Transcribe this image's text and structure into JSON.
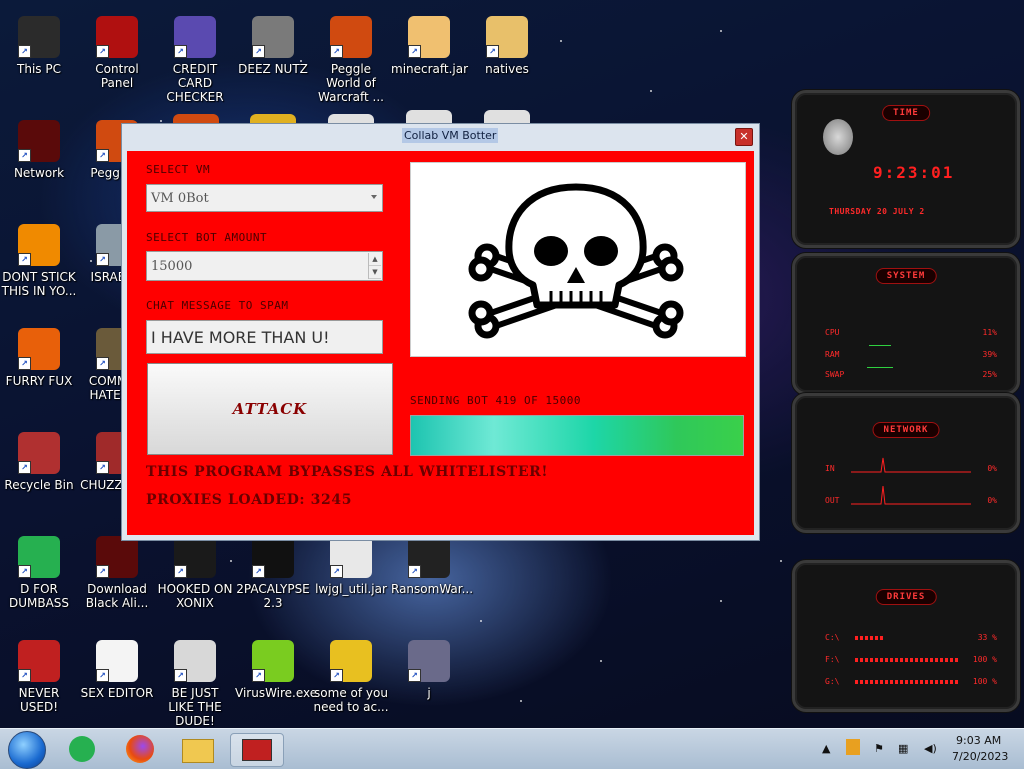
{
  "desktop": {
    "icons": [
      {
        "label": "This PC",
        "icon": "computer-icon",
        "color": "#2b2b2b"
      },
      {
        "label": "Control Panel",
        "icon": "control-panel-icon",
        "color": "#b01010"
      },
      {
        "label": "CREDIT CARD CHECKER",
        "icon": "credit-card-icon",
        "color": "#5a4ab0"
      },
      {
        "label": "DEEZ NUTZ",
        "icon": "windows-stack-icon",
        "color": "#7a7a7a"
      },
      {
        "label": "Peggle World of Warcraft ...",
        "icon": "peggle-icon",
        "color": "#d04a10"
      },
      {
        "label": "minecraft.jar",
        "icon": "cartoon-jar-icon",
        "color": "#f0c070"
      },
      {
        "label": "natives",
        "icon": "folder-icon",
        "color": "#e8c06a"
      },
      {
        "label": "Network",
        "icon": "alien-network-icon",
        "color": "#5a0a0a"
      },
      {
        "label": "Peggle D",
        "icon": "peggle-icon",
        "color": "#d04a10"
      },
      {
        "label": "DONT STICK THIS IN YO...",
        "icon": "vlc-cone-icon",
        "color": "#f08a00"
      },
      {
        "label": "ISRAEL S",
        "icon": "water-faucet-icon",
        "color": "#8a9aa6"
      },
      {
        "label": "FURRY FUX",
        "icon": "firefox-icon",
        "color": "#e8600a"
      },
      {
        "label": "COMMUN HATE THI",
        "icon": "money-bag-icon",
        "color": "#6a5a3a"
      },
      {
        "label": "Recycle Bin",
        "icon": "recycle-bin-icon",
        "color": "#b03030"
      },
      {
        "label": "CHUZZ CUM",
        "icon": "chuzzle-icon",
        "color": "#a02a2a"
      },
      {
        "label": "D FOR DUMBASS",
        "icon": "feedly-icon",
        "color": "#26b050"
      },
      {
        "label": "Download Black Ali...",
        "icon": "alien-download-icon",
        "color": "#5a0a0a"
      },
      {
        "label": "HOOKED ON XONIX",
        "icon": "xonix-icon",
        "color": "#1a1a1a"
      },
      {
        "label": "2PACALYPSE 2.3",
        "icon": "terminal-icon",
        "color": "#111111"
      },
      {
        "label": "lwjgl_util.jar",
        "icon": "java-icon",
        "color": "#e8e8e8"
      },
      {
        "label": "RansomWar...",
        "icon": "skull-icon",
        "color": "#222222"
      },
      {
        "label": "NEVER USED!",
        "icon": "dev-cpp-icon",
        "color": "#c02020"
      },
      {
        "label": "SEX EDITOR",
        "icon": "hxd-icon",
        "color": "#f4f4f4"
      },
      {
        "label": "BE JUST LIKE THE DUDE!",
        "icon": "santa-icon",
        "color": "#d8d8d8"
      },
      {
        "label": "VirusWire.exe",
        "icon": "limewire-icon",
        "color": "#7acc20"
      },
      {
        "label": "some of you need to ac...",
        "icon": "beaver-icon",
        "color": "#e8c020"
      },
      {
        "label": "j",
        "icon": "shortcut-file-icon",
        "color": "#6a6a8a"
      }
    ],
    "partial_icons": [
      {
        "icon": "peggle-icon",
        "color": "#d04a10"
      },
      {
        "icon": "deluge-icon",
        "color": "#e0b020"
      },
      {
        "icon": "app-icon",
        "color": "#e0e0e0"
      },
      {
        "icon": "shortcut-file-icon",
        "color": "#e0e0e0"
      },
      {
        "icon": "java-icon",
        "color": "#e0e0e0"
      }
    ]
  },
  "window": {
    "title": "Collab VM Botter",
    "select_vm_label": "SELECT VM",
    "select_vm_value": "VM 0Bot",
    "bot_amount_label": "SELECT BOT AMOUNT",
    "bot_amount_value": "15000",
    "chat_label": "CHAT MESSAGE TO SPAM",
    "chat_value": "I HAVE MORE THAN U!",
    "attack_label": "ATTACK",
    "status_text": "SENDING BOT 419 OF 15000",
    "progress_fraction": 1.0,
    "bypass_text": "THIS PROGRAM BYPASSES ALL WHITELISTER!",
    "proxies_text": "PROXIES LOADED: 3245",
    "image_icon": "skull-crossbones-icon",
    "panel_color": "#ff0000"
  },
  "widgets": {
    "time": {
      "title": "TIME",
      "clock": "9:23:01",
      "date": "THURSDAY 20 JULY 2"
    },
    "system": {
      "title": "SYSTEM",
      "rows": [
        {
          "label": "CPU",
          "value": "11%"
        },
        {
          "label": "RAM",
          "value": "39%"
        },
        {
          "label": "SWAP",
          "value": "25%"
        }
      ]
    },
    "network": {
      "title": "NETWORK",
      "rows": [
        {
          "label": "IN",
          "value": "0%"
        },
        {
          "label": "OUT",
          "value": "0%"
        }
      ]
    },
    "drives": {
      "title": "DRIVES",
      "rows": [
        {
          "label": "C:\\",
          "value": "33 %"
        },
        {
          "label": "F:\\",
          "value": "100 %"
        },
        {
          "label": "G:\\",
          "value": "100 %"
        }
      ]
    }
  },
  "taskbar": {
    "time": "9:03 AM",
    "date": "7/20/2023",
    "pinned": [
      "start-orb-icon",
      "feedly-icon",
      "firefox-icon",
      "file-explorer-icon",
      "active-app-icon"
    ]
  }
}
